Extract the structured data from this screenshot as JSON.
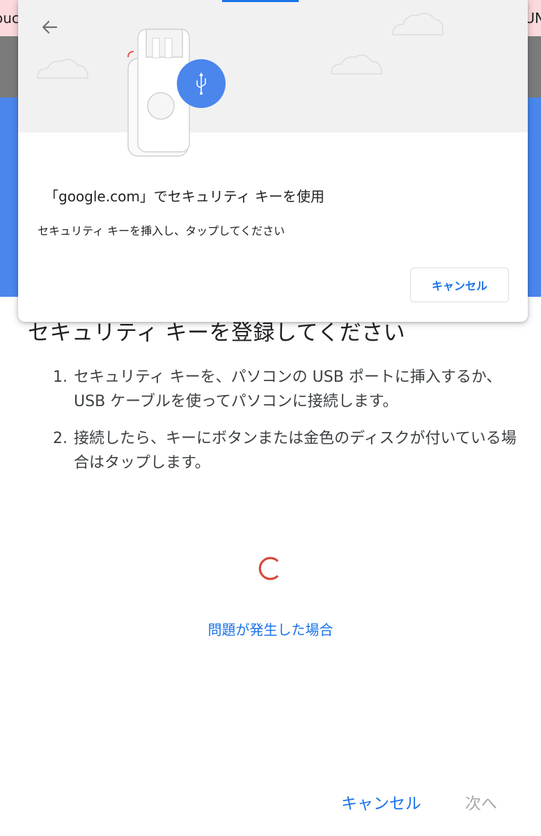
{
  "background": {
    "top_strip_left_text": "ouc",
    "top_strip_right_text": "UN"
  },
  "dialog": {
    "title": "「google.com」でセキュリティ キーを使用",
    "description": "セキュリティ キーを挿入し、タップしてください",
    "cancel_label": "キャンセル",
    "back_icon": "arrow-left-icon",
    "usb_icon": "usb-icon",
    "illustration": "security-key-illustration"
  },
  "main": {
    "heading": "セキュリティ キーを登録してください",
    "steps": [
      {
        "number": "1.",
        "text": "セキュリティ キーを、パソコンの USB ポートに挿入するか、USB ケーブルを使ってパソコンに接続します。"
      },
      {
        "number": "2.",
        "text": "接続したら、キーにボタンまたは金色のディスクが付いている場合はタップします。"
      }
    ],
    "help_link": "問題が発生した場合",
    "spinner_icon": "loading-spinner-icon"
  },
  "footer": {
    "cancel_label": "キャンセル",
    "next_label": "次へ"
  },
  "colors": {
    "accent_blue": "#1a73e8",
    "band_blue": "#4a86ec",
    "spinner_red": "#d9483b",
    "disabled_gray": "#a8a8a8",
    "top_strip_pink": "#fbd9dc"
  }
}
